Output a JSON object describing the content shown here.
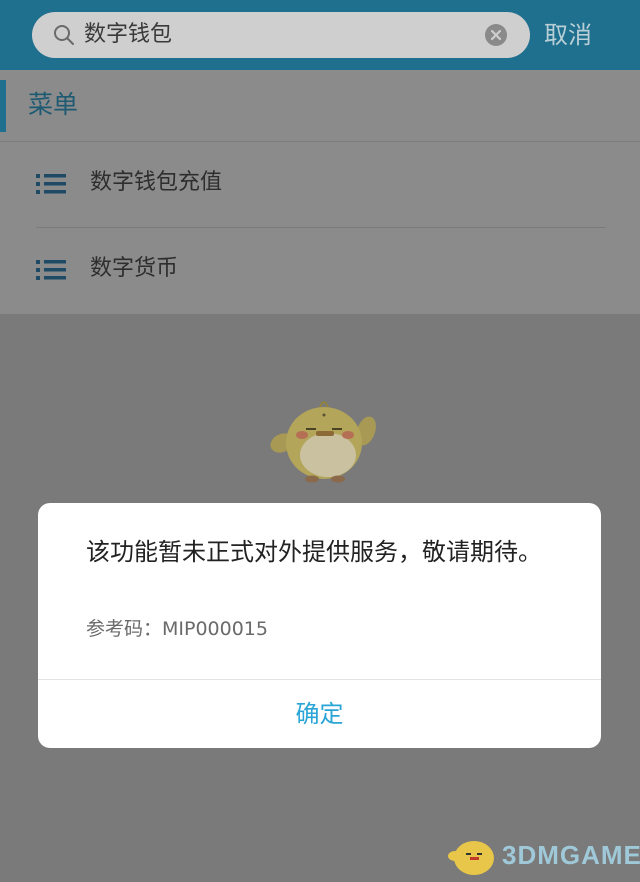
{
  "search": {
    "query": "数字钱包",
    "cancel_label": "取消"
  },
  "menu": {
    "title": "菜单",
    "items": [
      {
        "label": "数字钱包充值",
        "icon": "list-icon"
      },
      {
        "label": "数字货币",
        "icon": "list-icon"
      }
    ]
  },
  "dialog": {
    "message": "该功能暂未正式对外提供服务，敬请期待。",
    "reference": "参考码：MIP000015",
    "confirm_label": "确定"
  },
  "watermark": {
    "text": "3DMGAME"
  },
  "colors": {
    "header": "#1f6f8e",
    "accent": "#2aa5d6",
    "overlay_bg": "#7a7a7a"
  }
}
